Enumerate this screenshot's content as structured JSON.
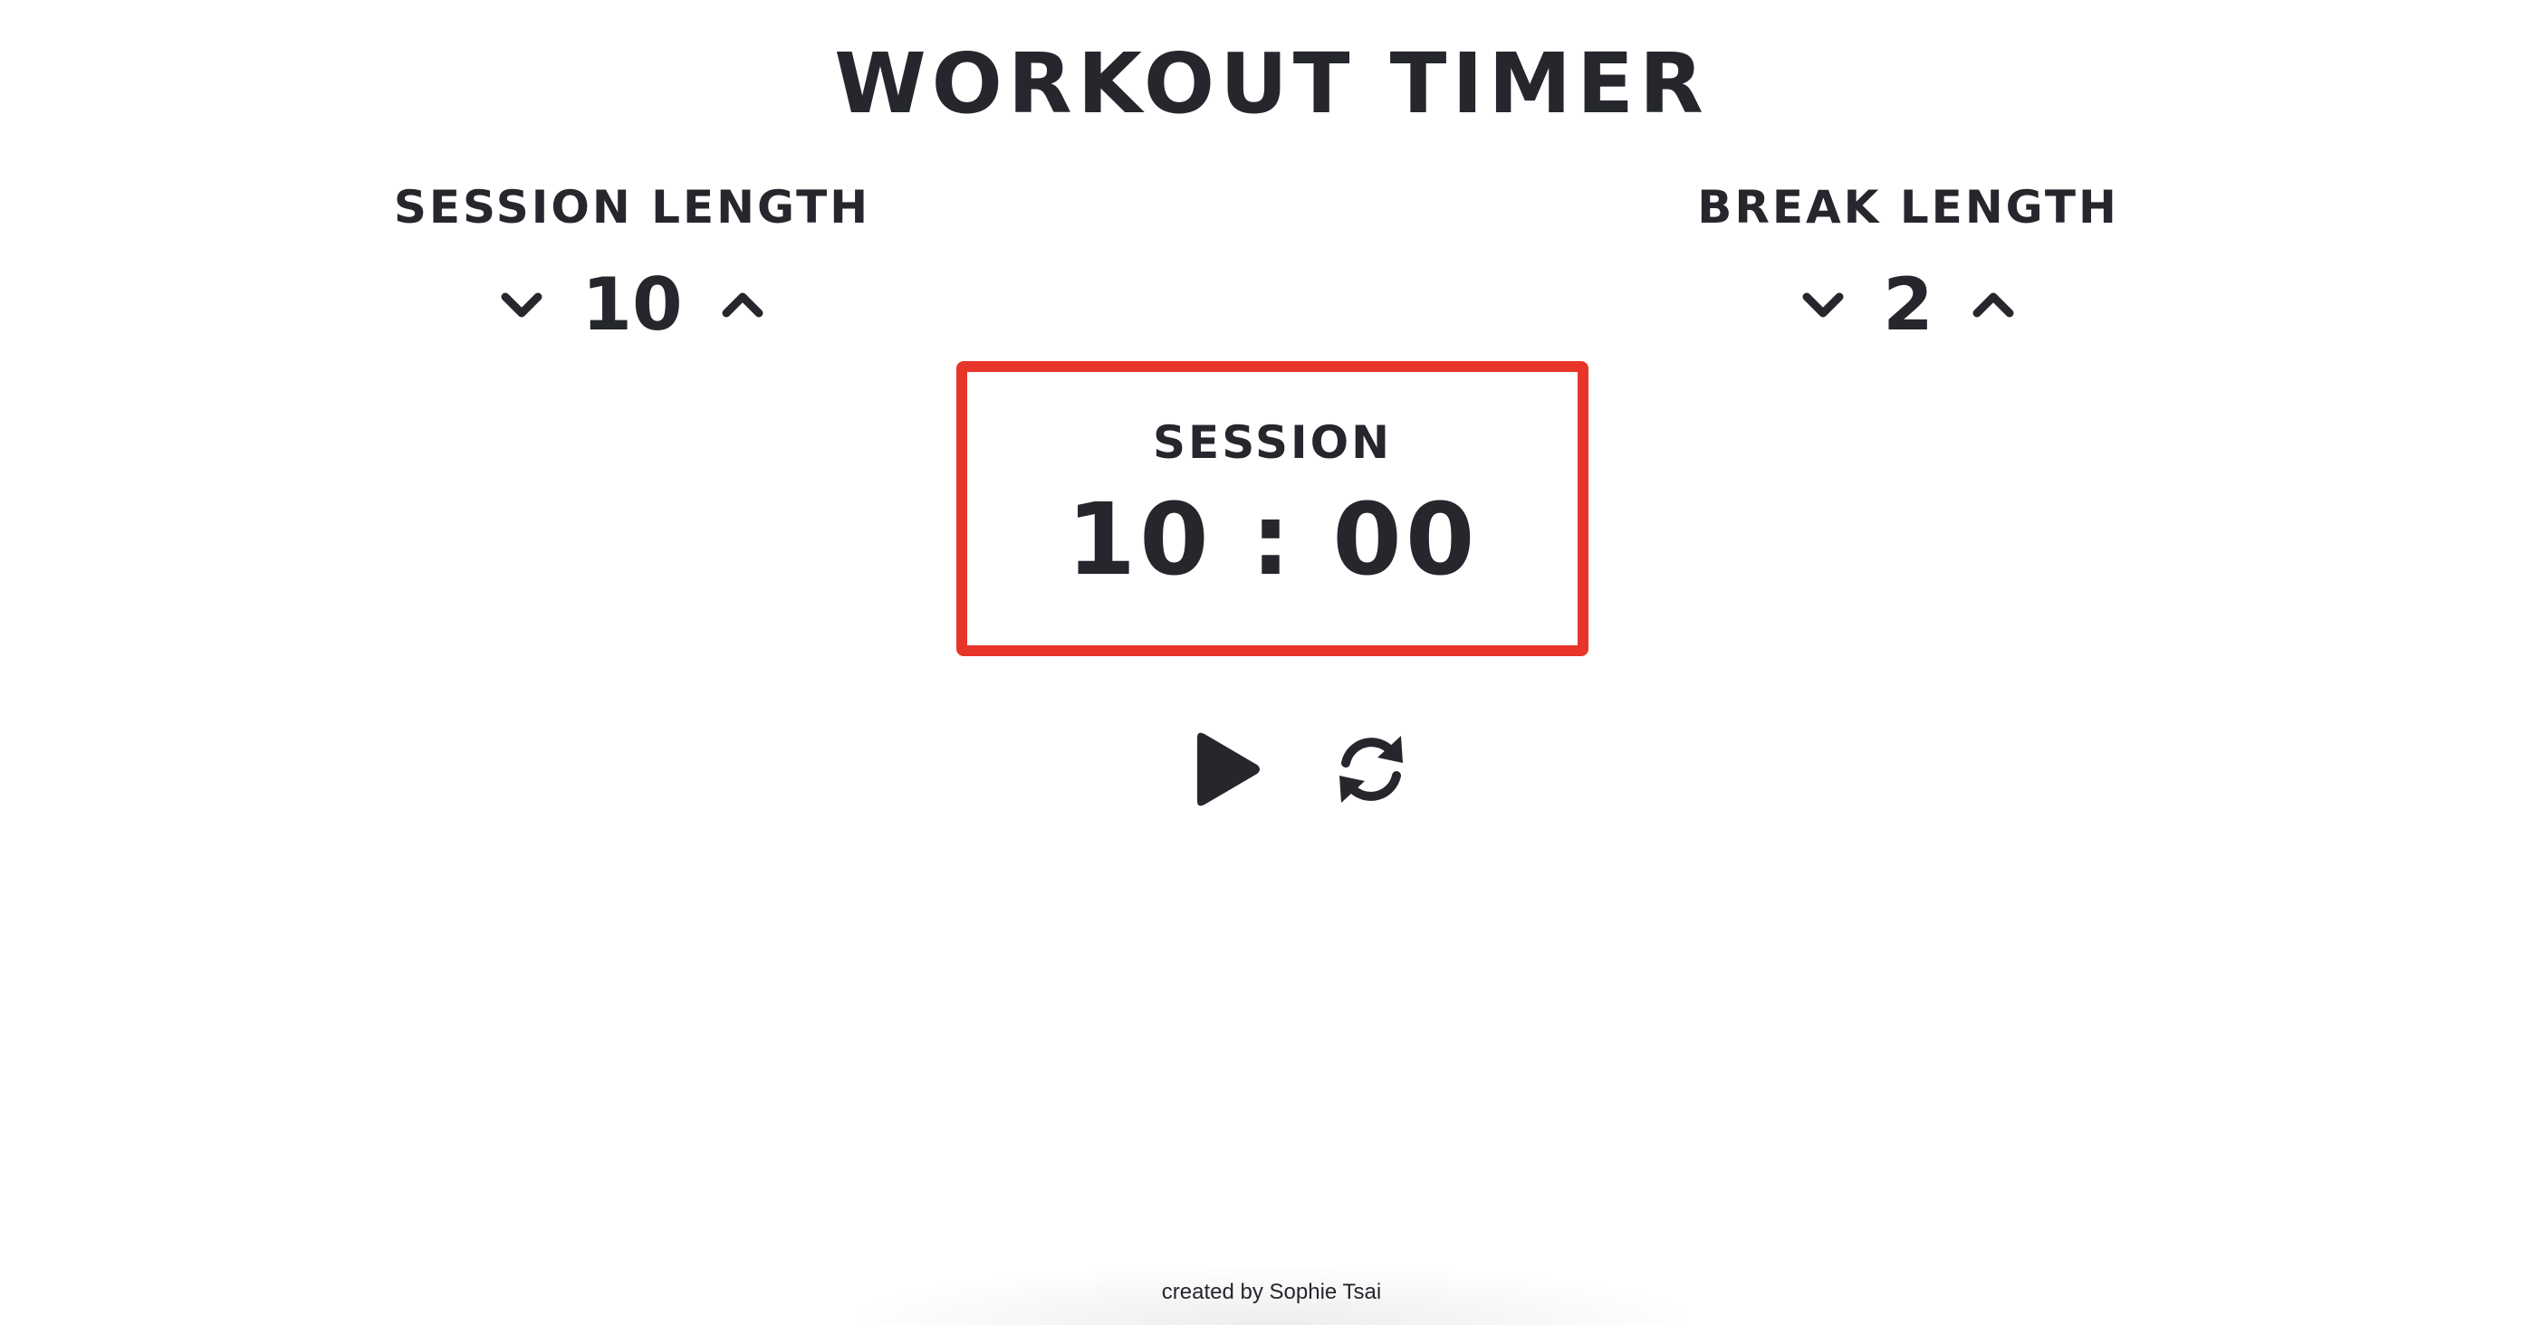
{
  "app": {
    "title": "WORKOUT TIMER"
  },
  "session_length": {
    "label": "SESSION LENGTH",
    "value": "10",
    "decrement_icon": "chevron-down-icon",
    "increment_icon": "chevron-up-icon"
  },
  "break_length": {
    "label": "BREAK LENGTH",
    "value": "2",
    "decrement_icon": "chevron-down-icon",
    "increment_icon": "chevron-up-icon"
  },
  "timer": {
    "label": "SESSION",
    "display": "10 : 00",
    "border_color": "#e8352a"
  },
  "controls": {
    "play_icon": "play-icon",
    "reset_icon": "refresh-icon"
  },
  "footer": {
    "credit": "created by Sophie Tsai"
  },
  "colors": {
    "text": "#25272d",
    "accent": "#e8352a",
    "background": "#ffffff"
  }
}
